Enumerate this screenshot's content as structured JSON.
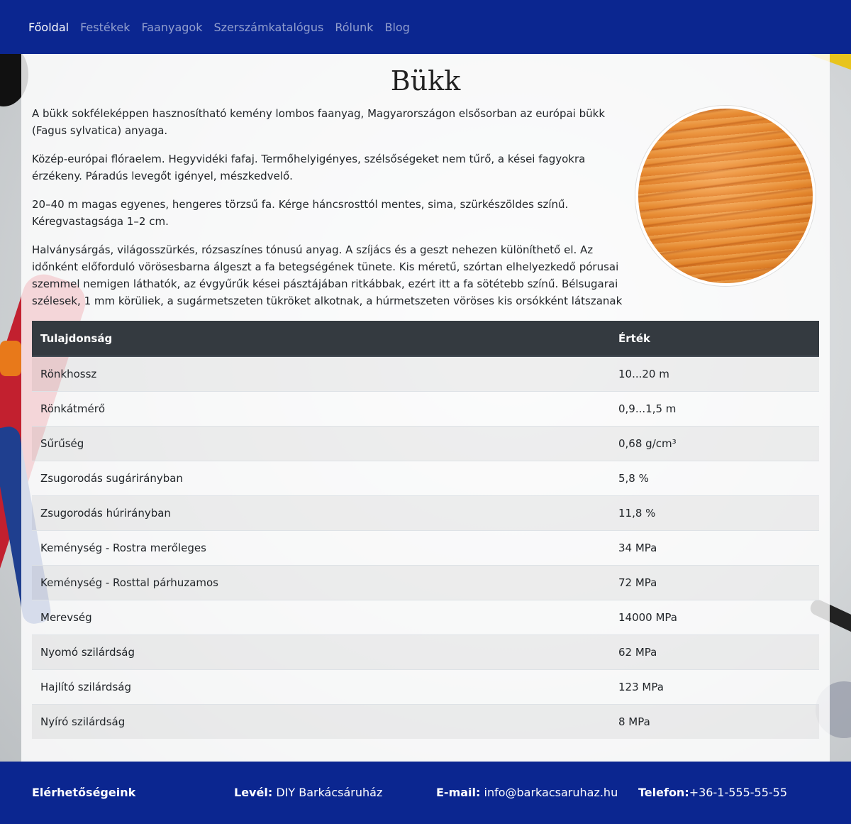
{
  "nav": {
    "items": [
      {
        "label": "Főoldal",
        "active": true
      },
      {
        "label": "Festékek",
        "active": false
      },
      {
        "label": "Faanyagok",
        "active": false
      },
      {
        "label": "Szerszámkatalógus",
        "active": false
      },
      {
        "label": "Rólunk",
        "active": false
      },
      {
        "label": "Blog",
        "active": false
      }
    ]
  },
  "main": {
    "title": "Bükk",
    "paragraphs": [
      "A bükk sokféleképpen hasznosítható kemény lombos faanyag, Magyarországon elsősorban az európai bükk (Fagus sylvatica) anyaga.",
      "Közép-európai flóraelem. Hegyvidéki fafaj. Termőhelyigényes, szélsőségeket nem tűrő, a kései fagyokra érzékeny. Páradús levegőt igényel, mészkedvelő.",
      "20–40 m magas egyenes, hengeres törzsű fa. Kérge háncsrosttól mentes, sima, szürkészöldes színű. Kéregvastagsága 1–2 cm.",
      "Halványsárgás, világosszürkés, rózsaszínes tónusú anyag. A szíjács és a geszt nehezen különíthető el. Az időnként előforduló vörösesbarna álgeszt a fa betegségének tünete. Kis méretű, szórtan elhelyezkedő pórusai szemmel nemigen láthatók, az évgyűrűk kései pásztájában ritkábbak, ezért itt a fa sötétebb színű. Bélsugarai szélesek, 1 mm körüliek, a sugármetszeten tükröket alkotnak, a húrmetszeten vöröses kis orsókként látszanak"
    ],
    "image": {
      "name": "beech-wood-image",
      "color": "#e68a30"
    },
    "table": {
      "headers": [
        "Tulajdonság",
        "Érték"
      ],
      "rows": [
        [
          "Rönkhossz",
          "10...20 m"
        ],
        [
          "Rönkátmérő",
          "0,9...1,5 m"
        ],
        [
          "Sűrűség",
          "0,68 g/cm³"
        ],
        [
          "Zsugorodás sugárirányban",
          "5,8 %"
        ],
        [
          "Zsugorodás húrirányban",
          "11,8 %"
        ],
        [
          "Keménység - Rostra merőleges",
          "34 MPa"
        ],
        [
          "Keménység - Rosttal párhuzamos",
          "72 MPa"
        ],
        [
          "Merevség",
          "14000 MPa"
        ],
        [
          "Nyomó szilárdság",
          "62 MPa"
        ],
        [
          "Hajlító szilárdság",
          "123 MPa"
        ],
        [
          "Nyíró szilárdság",
          "8 MPa"
        ]
      ]
    }
  },
  "footer": {
    "heading": "Elérhetőségeink",
    "letter_label": "Levél:",
    "letter_value": "DIY Barkácsáruház",
    "email_label": "E-mail:",
    "email_value": "info@barkacsaruhaz.hu",
    "phone_label": "Telefon:",
    "phone_value": "+36-1-555-55-55"
  },
  "colors": {
    "nav_bg": "#0b2690",
    "table_header_bg": "#343a40"
  }
}
